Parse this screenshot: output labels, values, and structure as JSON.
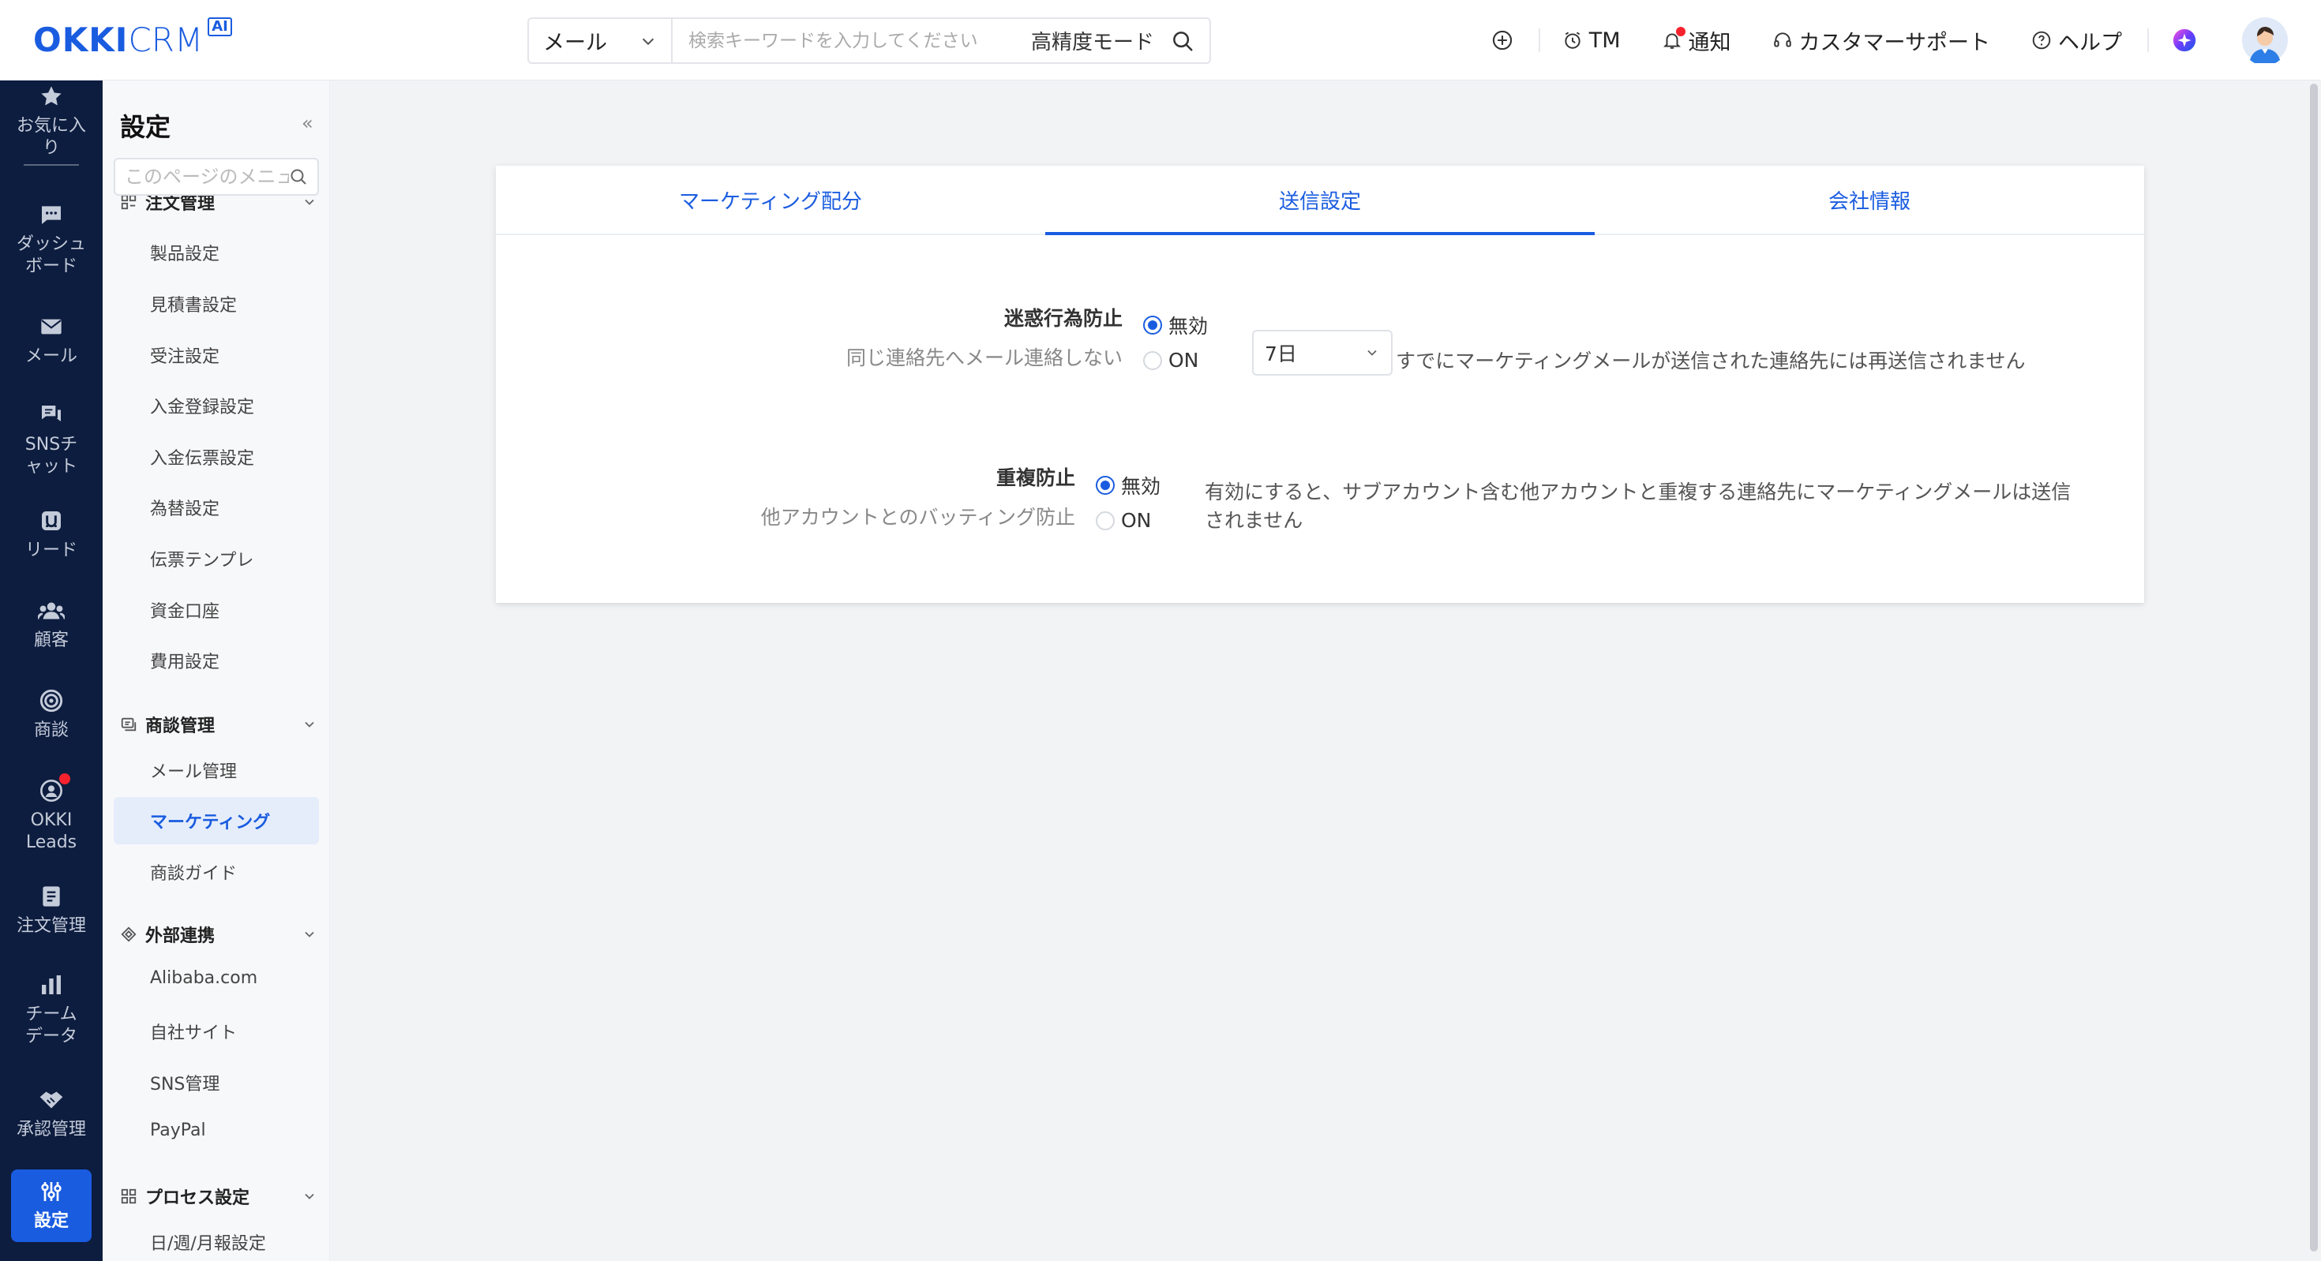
{
  "topbar": {
    "logo_main": "OKKI",
    "logo_crm": "CRM",
    "logo_badge": "AI",
    "search_scope": "メール",
    "search_placeholder": "検索キーワードを入力してください",
    "search_mode": "高精度モード",
    "tm_label": "TM",
    "notify_label": "通知",
    "support_label": "カスタマーサポート",
    "help_label": "ヘルプ"
  },
  "rail": {
    "favorites": "お気に入り",
    "dashboard": "ダッシュボード",
    "mail": "メール",
    "sns": "SNSチャット",
    "lead": "リード",
    "customer": "顧客",
    "deal": "商談",
    "okki_leads": "OKKI Leads",
    "order": "注文管理",
    "team_data": "チームデータ",
    "approval": "承認管理",
    "settings": "設定"
  },
  "sidebar": {
    "title": "設定",
    "collapse": "«",
    "search_placeholder": "このページのメニューを検索",
    "group_order": "注文管理",
    "order_items": [
      "製品設定",
      "見積書設定",
      "受注設定",
      "入金登録設定",
      "入金伝票設定",
      "為替設定",
      "伝票テンプレ",
      "資金口座",
      "費用設定"
    ],
    "group_deal": "商談管理",
    "deal_items": [
      "メール管理",
      "マーケティング",
      "商談ガイド"
    ],
    "group_external": "外部連携",
    "external_items": [
      "Alibaba.com",
      "自社サイト",
      "SNS管理",
      "PayPal"
    ],
    "group_process": "プロセス設定",
    "process_items": [
      "日/週/月報設定"
    ]
  },
  "tabs": [
    "マーケティング配分",
    "送信設定",
    "会社情報"
  ],
  "settings": {
    "spam": {
      "title": "迷惑行為防止",
      "subtitle": "同じ連絡先へメール連絡しない",
      "option_off": "無効",
      "option_on": "ON",
      "period": "7日",
      "description": "すでにマーケティングメールが送信された連絡先には再送信されません"
    },
    "dup": {
      "title": "重複防止",
      "subtitle": "他アカウントとのバッティング防止",
      "option_off": "無効",
      "option_on": "ON",
      "description_line1": "有効にすると、サブアカウント含む他アカウントと重複する連絡先にマーケティングメールは送信",
      "description_line2": "されません"
    }
  },
  "colors": {
    "accent": "#1a5ce0",
    "rail_bg": "#0d1d3f",
    "badge_red": "#f5222d"
  }
}
